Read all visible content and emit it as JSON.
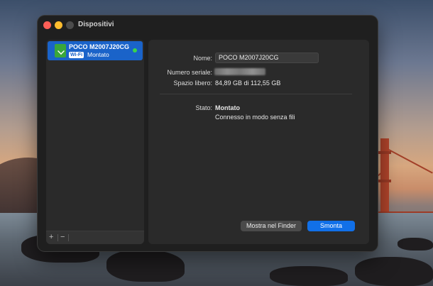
{
  "window": {
    "title": "Dispositivi"
  },
  "sidebar": {
    "device": {
      "name": "POCO M2007J20CG",
      "badge": "Wi-Fi",
      "status": "Montato"
    },
    "footer": {
      "add": "+",
      "remove": "−"
    }
  },
  "details": {
    "name_label": "Nome:",
    "name_value": "POCO M2007J20CG",
    "serial_label": "Numero seriale:",
    "free_label": "Spazio libero:",
    "free_value": "84,89 GB di 112,55 GB",
    "state_label": "Stato:",
    "state_value": "Montato",
    "connection": "Connesso in modo senza fili"
  },
  "buttons": {
    "show_in_finder": "Mostra nel Finder",
    "unmount": "Smonta"
  },
  "colors": {
    "accent": "#1170e8",
    "selection": "#1a63c9",
    "status_dot": "#3bd44a"
  },
  "icons": {
    "device": "android-phone-icon"
  }
}
